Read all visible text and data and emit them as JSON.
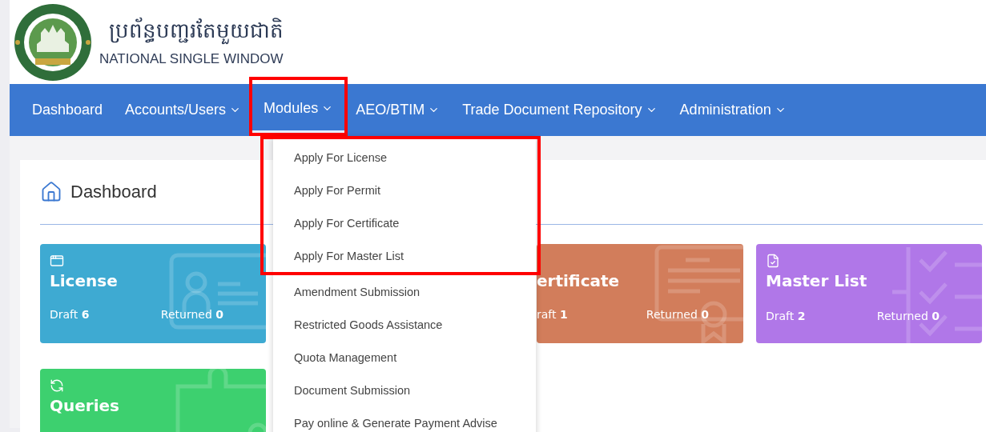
{
  "header": {
    "title_khmer": "ប្រព័ន្ធបញ្ជរតែមួយជាតិ",
    "title": "NATIONAL SINGLE WINDOW"
  },
  "nav": [
    {
      "label": "Dashboard",
      "dropdown": false,
      "selected": false
    },
    {
      "label": "Accounts/Users",
      "dropdown": true,
      "selected": false
    },
    {
      "label": "Modules",
      "dropdown": true,
      "selected": true
    },
    {
      "label": "AEO/BTIM",
      "dropdown": true,
      "selected": false
    },
    {
      "label": "Trade Document Repository",
      "dropdown": true,
      "selected": false
    },
    {
      "label": "Administration",
      "dropdown": true,
      "selected": false
    }
  ],
  "menu": {
    "items": [
      {
        "label": "Apply For License",
        "highlighted": true
      },
      {
        "label": "Apply For Permit",
        "highlighted": true
      },
      {
        "label": "Apply For Certificate",
        "highlighted": true
      },
      {
        "label": "Apply For Master List",
        "highlighted": true
      },
      {
        "label": "Amendment Submission",
        "highlighted": false
      },
      {
        "label": "Restricted Goods Assistance",
        "highlighted": false
      },
      {
        "label": "Quota Management",
        "highlighted": false
      },
      {
        "label": "Document Submission",
        "highlighted": false
      },
      {
        "label": "Pay online & Generate Payment Advise",
        "highlighted": false
      }
    ]
  },
  "page": {
    "title": "Dashboard"
  },
  "cards": [
    {
      "kind": "license",
      "title": "License",
      "color": "#3eaad2",
      "covered": false,
      "draft_label": "Draft",
      "draft": "6",
      "returned_label": "Returned",
      "returned": "0"
    },
    {
      "kind": "certificate",
      "title": "ertificate",
      "color": "#d27d5b",
      "covered": true,
      "draft_label": "raft",
      "draft": "1",
      "returned_label": "Returned",
      "returned": "0"
    },
    {
      "kind": "masterlist",
      "title": "Master List",
      "color": "#b077e8",
      "covered": false,
      "draft_label": "Draft",
      "draft": "2",
      "returned_label": "Returned",
      "returned": "0"
    },
    {
      "kind": "queries",
      "title": "Queries",
      "color": "#3dd06f",
      "covered": false
    }
  ]
}
